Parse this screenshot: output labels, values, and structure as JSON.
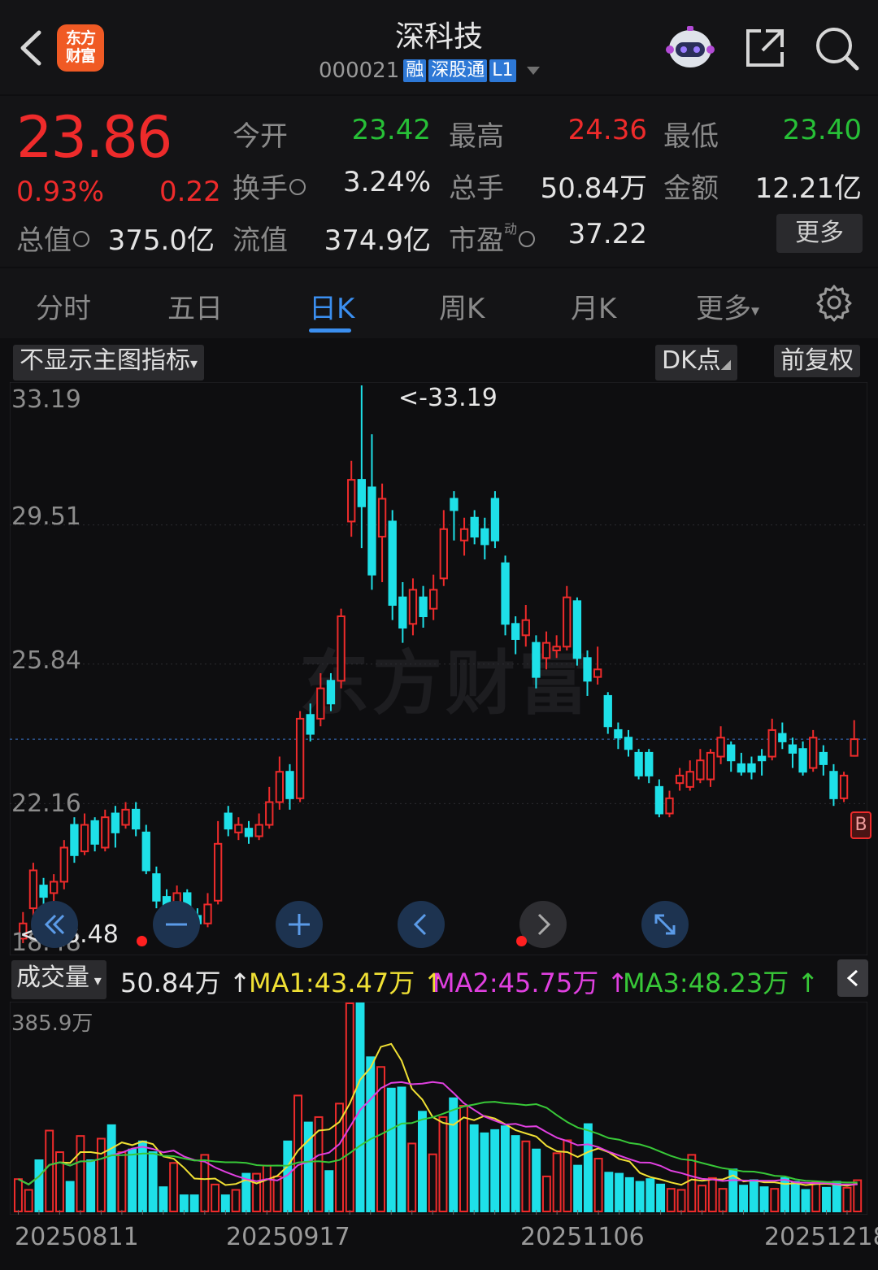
{
  "header": {
    "title": "深科技",
    "code": "000021",
    "tags": [
      "融",
      "深股通",
      "L1"
    ],
    "logo_text": [
      "东方",
      "财富"
    ],
    "icons": [
      "back-icon",
      "robot-icon",
      "share-icon",
      "search-icon"
    ]
  },
  "quote": {
    "price": "23.86",
    "change_pct": "0.93%",
    "change": "0.22",
    "open_label": "今开",
    "open": "23.42",
    "high_label": "最高",
    "high": "24.36",
    "low_label": "最低",
    "low": "23.40",
    "turnover_label": "换手",
    "turnover": "3.24%",
    "volume_label": "总手",
    "volume": "50.84万",
    "amount_label": "金额",
    "amount": "12.21亿",
    "mktcap_label": "总值",
    "mktcap": "375.0亿",
    "float_label": "流值",
    "float": "374.9亿",
    "pe_label": "市盈",
    "pe_sup": "动",
    "pe": "37.22",
    "more": "更多"
  },
  "tabs": {
    "items": [
      "分时",
      "五日",
      "日K",
      "周K",
      "月K",
      "更多"
    ],
    "active": "日K"
  },
  "toolbar": {
    "indicator": "不显示主图指标",
    "dk": "DK点",
    "adjust": "前复权"
  },
  "chart": {
    "y_labels": [
      "33.19",
      "29.51",
      "25.84",
      "22.16",
      "18.48"
    ],
    "max_marker": "<-33.19",
    "min_marker": "<-18.48",
    "watermark": "东方财富",
    "b_marker": "B"
  },
  "volume": {
    "selector": "成交量",
    "current": "50.84万 ↑",
    "ma1": "MA1:43.47万 ↑",
    "ma2": "MA2:45.75万 ↑",
    "ma3": "MA3:48.23万 ↑",
    "max_label": "385.9万",
    "dates": [
      "20250811",
      "20250917",
      "20251106",
      "20251218"
    ]
  },
  "colors": {
    "up": "#ee2b2b",
    "down": "#1ee0e8",
    "ma1": "#f0e034",
    "ma2": "#e040e0",
    "ma3": "#38c838",
    "accent": "#3b8ff0"
  },
  "chart_data": {
    "type": "candlestick",
    "y_range": [
      18.48,
      33.19
    ],
    "candles": [
      {
        "o": 18.6,
        "c": 19.0,
        "h": 19.3,
        "l": 18.48
      },
      {
        "o": 19.4,
        "c": 20.4,
        "h": 20.6,
        "l": 19.2
      },
      {
        "o": 20.0,
        "c": 19.7,
        "h": 20.2,
        "l": 19.3
      },
      {
        "o": 19.8,
        "c": 20.1,
        "h": 20.3,
        "l": 19.5
      },
      {
        "o": 20.1,
        "c": 21.0,
        "h": 21.2,
        "l": 19.9
      },
      {
        "o": 21.6,
        "c": 20.8,
        "h": 21.8,
        "l": 20.6
      },
      {
        "o": 20.9,
        "c": 21.6,
        "h": 21.9,
        "l": 20.8
      },
      {
        "o": 21.7,
        "c": 21.1,
        "h": 21.8,
        "l": 20.9
      },
      {
        "o": 21.0,
        "c": 21.8,
        "h": 22.0,
        "l": 20.9
      },
      {
        "o": 21.9,
        "c": 21.4,
        "h": 22.1,
        "l": 21.0
      },
      {
        "o": 21.6,
        "c": 22.0,
        "h": 22.2,
        "l": 21.5
      },
      {
        "o": 22.0,
        "c": 21.5,
        "h": 22.2,
        "l": 21.3
      },
      {
        "o": 21.4,
        "c": 20.4,
        "h": 21.6,
        "l": 20.3
      },
      {
        "o": 20.3,
        "c": 19.6,
        "h": 20.5,
        "l": 19.4
      },
      {
        "o": 19.7,
        "c": 18.8,
        "h": 19.9,
        "l": 18.6
      },
      {
        "o": 18.9,
        "c": 19.8,
        "h": 20.0,
        "l": 18.7
      },
      {
        "o": 19.8,
        "c": 19.2,
        "h": 19.9,
        "l": 19.0
      },
      {
        "o": 19.2,
        "c": 19.0,
        "h": 19.4,
        "l": 18.8
      },
      {
        "o": 19.0,
        "c": 19.5,
        "h": 19.8,
        "l": 18.9
      },
      {
        "o": 19.6,
        "c": 21.1,
        "h": 21.7,
        "l": 19.5
      },
      {
        "o": 21.9,
        "c": 21.5,
        "h": 22.1,
        "l": 21.3
      },
      {
        "o": 21.4,
        "c": 21.6,
        "h": 21.8,
        "l": 21.2
      },
      {
        "o": 21.5,
        "c": 21.3,
        "h": 21.7,
        "l": 21.1
      },
      {
        "o": 21.3,
        "c": 21.6,
        "h": 21.9,
        "l": 21.2
      },
      {
        "o": 21.6,
        "c": 22.2,
        "h": 22.6,
        "l": 21.5
      },
      {
        "o": 22.2,
        "c": 23.0,
        "h": 23.4,
        "l": 22.0
      },
      {
        "o": 23.0,
        "c": 22.3,
        "h": 23.2,
        "l": 22.0
      },
      {
        "o": 22.3,
        "c": 24.4,
        "h": 24.6,
        "l": 22.2
      },
      {
        "o": 24.5,
        "c": 24.0,
        "h": 24.8,
        "l": 23.8
      },
      {
        "o": 24.4,
        "c": 25.2,
        "h": 25.6,
        "l": 24.2
      },
      {
        "o": 25.4,
        "c": 24.8,
        "h": 25.6,
        "l": 24.6
      },
      {
        "o": 25.4,
        "c": 27.1,
        "h": 27.3,
        "l": 25.2
      },
      {
        "o": 29.6,
        "c": 30.7,
        "h": 31.2,
        "l": 29.2
      },
      {
        "o": 30.7,
        "c": 30.0,
        "h": 33.19,
        "l": 28.9
      },
      {
        "o": 30.5,
        "c": 28.2,
        "h": 31.9,
        "l": 27.8
      },
      {
        "o": 29.2,
        "c": 30.2,
        "h": 30.6,
        "l": 28.0
      },
      {
        "o": 29.6,
        "c": 27.4,
        "h": 29.9,
        "l": 27.0
      },
      {
        "o": 27.6,
        "c": 26.8,
        "h": 28.0,
        "l": 26.4
      },
      {
        "o": 26.9,
        "c": 27.8,
        "h": 28.1,
        "l": 26.6
      },
      {
        "o": 27.6,
        "c": 27.1,
        "h": 27.9,
        "l": 26.8
      },
      {
        "o": 27.3,
        "c": 27.8,
        "h": 28.2,
        "l": 27.0
      },
      {
        "o": 28.1,
        "c": 29.4,
        "h": 29.9,
        "l": 27.9
      },
      {
        "o": 30.2,
        "c": 29.9,
        "h": 30.4,
        "l": 29.1
      },
      {
        "o": 29.1,
        "c": 29.4,
        "h": 29.7,
        "l": 28.7
      },
      {
        "o": 29.7,
        "c": 29.2,
        "h": 29.9,
        "l": 29.0
      },
      {
        "o": 29.4,
        "c": 29.0,
        "h": 29.7,
        "l": 28.6
      },
      {
        "o": 30.2,
        "c": 29.1,
        "h": 30.4,
        "l": 28.9
      },
      {
        "o": 28.5,
        "c": 26.9,
        "h": 28.7,
        "l": 26.6
      },
      {
        "o": 26.9,
        "c": 26.5,
        "h": 27.1,
        "l": 26.1
      },
      {
        "o": 26.6,
        "c": 27.0,
        "h": 27.4,
        "l": 26.3
      },
      {
        "o": 26.4,
        "c": 25.5,
        "h": 26.6,
        "l": 25.2
      },
      {
        "o": 26.0,
        "c": 26.4,
        "h": 26.7,
        "l": 25.7
      },
      {
        "o": 26.2,
        "c": 26.3,
        "h": 26.6,
        "l": 26.0
      },
      {
        "o": 26.3,
        "c": 27.6,
        "h": 27.9,
        "l": 26.2
      },
      {
        "o": 27.5,
        "c": 26.0,
        "h": 27.6,
        "l": 25.8
      },
      {
        "o": 26.0,
        "c": 25.4,
        "h": 26.2,
        "l": 25.0
      },
      {
        "o": 25.5,
        "c": 25.7,
        "h": 26.3,
        "l": 25.3
      },
      {
        "o": 25.0,
        "c": 24.2,
        "h": 25.1,
        "l": 24.0
      },
      {
        "o": 24.1,
        "c": 23.9,
        "h": 24.3,
        "l": 23.6
      },
      {
        "o": 23.9,
        "c": 23.6,
        "h": 24.1,
        "l": 23.4
      },
      {
        "o": 23.5,
        "c": 22.9,
        "h": 23.6,
        "l": 22.8
      },
      {
        "o": 23.5,
        "c": 22.9,
        "h": 23.6,
        "l": 22.7
      },
      {
        "o": 22.6,
        "c": 21.9,
        "h": 22.8,
        "l": 21.8
      },
      {
        "o": 21.9,
        "c": 22.3,
        "h": 22.5,
        "l": 21.8
      },
      {
        "o": 22.7,
        "c": 22.9,
        "h": 23.1,
        "l": 22.5
      },
      {
        "o": 22.6,
        "c": 23.0,
        "h": 23.3,
        "l": 22.5
      },
      {
        "o": 22.8,
        "c": 23.3,
        "h": 23.6,
        "l": 22.7
      },
      {
        "o": 22.8,
        "c": 23.5,
        "h": 23.6,
        "l": 22.6
      },
      {
        "o": 23.4,
        "c": 23.9,
        "h": 24.2,
        "l": 23.2
      },
      {
        "o": 23.7,
        "c": 23.3,
        "h": 23.8,
        "l": 23.0
      },
      {
        "o": 23.2,
        "c": 23.0,
        "h": 23.5,
        "l": 22.9
      },
      {
        "o": 23.2,
        "c": 23.0,
        "h": 23.4,
        "l": 22.8
      },
      {
        "o": 23.4,
        "c": 23.3,
        "h": 23.6,
        "l": 22.9
      },
      {
        "o": 23.4,
        "c": 24.1,
        "h": 24.4,
        "l": 23.3
      },
      {
        "o": 24.0,
        "c": 23.8,
        "h": 24.3,
        "l": 23.6
      },
      {
        "o": 23.7,
        "c": 23.5,
        "h": 23.9,
        "l": 23.1
      },
      {
        "o": 23.6,
        "c": 23.0,
        "h": 23.8,
        "l": 22.9
      },
      {
        "o": 23.1,
        "c": 23.9,
        "h": 24.1,
        "l": 23.0
      },
      {
        "o": 23.5,
        "c": 23.2,
        "h": 23.7,
        "l": 22.9
      },
      {
        "o": 23.0,
        "c": 22.3,
        "h": 23.2,
        "l": 22.1
      },
      {
        "o": 22.3,
        "c": 22.9,
        "h": 23.0,
        "l": 22.2
      },
      {
        "o": 23.42,
        "c": 23.86,
        "h": 24.36,
        "l": 23.4
      }
    ],
    "volumes_wan": [
      60,
      40,
      95,
      150,
      110,
      55,
      140,
      95,
      135,
      160,
      110,
      115,
      130,
      110,
      45,
      90,
      30,
      30,
      105,
      50,
      30,
      40,
      70,
      70,
      85,
      65,
      130,
      215,
      165,
      175,
      75,
      200,
      386,
      386,
      286,
      268,
      228,
      230,
      126,
      185,
      106,
      175,
      210,
      196,
      160,
      145,
      151,
      158,
      140,
      130,
      115,
      65,
      108,
      132,
      85,
      162,
      98,
      72,
      70,
      62,
      55,
      60,
      50,
      42,
      40,
      105,
      48,
      62,
      42,
      78,
      48,
      58,
      45,
      42,
      62,
      55,
      40,
      55,
      44,
      55,
      44,
      58
    ]
  }
}
